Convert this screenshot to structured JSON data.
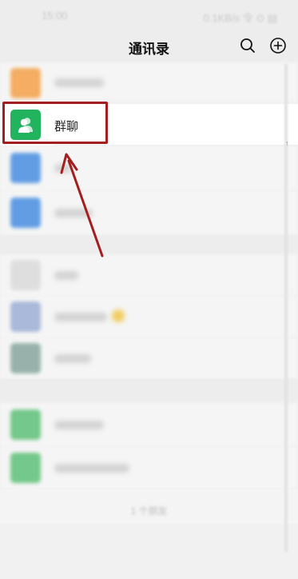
{
  "status_bar": {
    "time": "15:00",
    "speed": "0.1KB/s 令 ⊙ ▤"
  },
  "header": {
    "title": "通讯录",
    "icons": [
      "search-icon",
      "add-icon"
    ]
  },
  "contacts": {
    "group_chat_label": "群聊"
  },
  "footer": {
    "count": "1 个朋友"
  },
  "colors": {
    "group_green": "#22b35f",
    "highlight_red": "#a31f1f",
    "new_friends_orange": "#f6a34a",
    "blue_icon": "#4a90e2"
  }
}
